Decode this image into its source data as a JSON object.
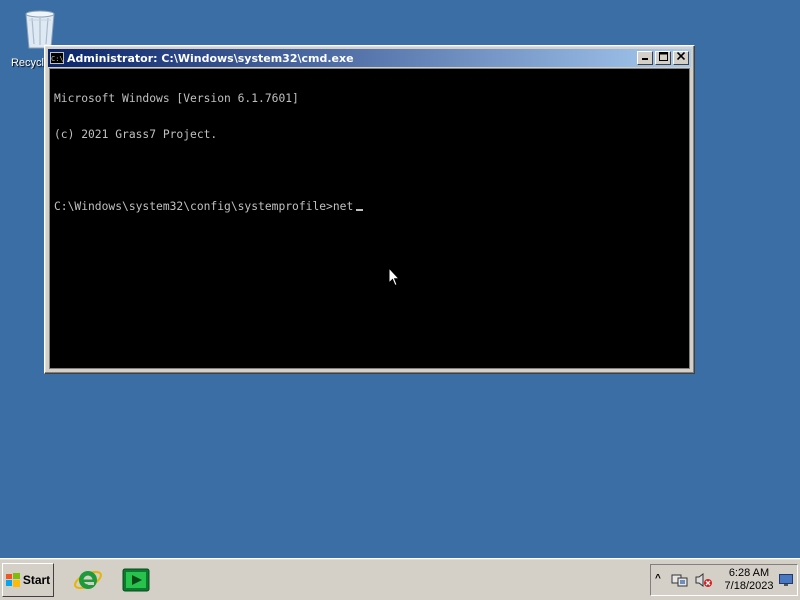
{
  "desktop": {
    "recycle_bin_label": "Recycle Bin"
  },
  "window": {
    "title": "Administrator: C:\\Windows\\system32\\cmd.exe",
    "app_icon": "cmd-icon",
    "controls": {
      "minimize_label": "_",
      "maximize_label": "□",
      "close_label": "✕"
    },
    "console_lines": [
      "Microsoft Windows [Version 6.1.7601]",
      "(c) 2021 Grass7 Project.",
      "",
      "C:\\Windows\\system32\\config\\systemprofile>net"
    ]
  },
  "taskbar": {
    "start_label": "Start",
    "quick_launch": [
      "internet-explorer-icon",
      "media-player-icon"
    ],
    "tray": {
      "overflow_label": "^",
      "clock_time": "6:28 AM",
      "clock_date": "7/18/2023"
    }
  },
  "colors": {
    "desktop": "#3a6ea5",
    "title_start": "#0a246a",
    "title_end": "#a6caf0",
    "console_bg": "#000000",
    "console_fg": "#c0c0c0",
    "chrome": "#d4d0c8"
  }
}
